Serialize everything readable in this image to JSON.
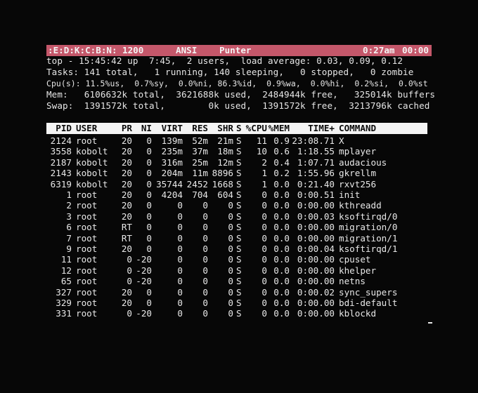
{
  "statusbar": {
    "flags": ":E:D:K:C:B:N:",
    "baud": "1200",
    "emulation": "ANSI",
    "program": "Punter",
    "clock": "0:27am",
    "timer": "00:00"
  },
  "summary": {
    "top": "top - 15:45:42 up  7:45,  2 users,  load average: 0.03, 0.09, 0.12",
    "tasks": "Tasks: 141 total,   1 running, 140 sleeping,   0 stopped,   0 zombie",
    "cpu": "Cpu(s): 11.5%us,  0.7%sy,  0.0%ni, 86.3%id,  0.9%wa,  0.0%hi,  0.2%si,  0.0%st",
    "mem": "Mem:   6106632k total,  3621688k used,  2484944k free,   325014k buffers",
    "swap": "Swap:  1391572k total,        0k used,  1391572k free,  3213796k cached"
  },
  "columns": [
    "PID",
    "USER",
    "PR",
    "NI",
    "VIRT",
    "RES",
    "SHR",
    "S",
    "%CPU",
    "%MEM",
    "TIME+",
    "COMMAND"
  ],
  "processes": [
    [
      "2124",
      "root",
      "20",
      "0",
      "139m",
      "52m",
      "21m",
      "S",
      "11",
      "0.9",
      "23:08.71",
      "X"
    ],
    [
      "3558",
      "kobolt",
      "20",
      "0",
      "235m",
      "37m",
      "18m",
      "S",
      "10",
      "0.6",
      "1:18.55",
      "mplayer"
    ],
    [
      "2187",
      "kobolt",
      "20",
      "0",
      "316m",
      "25m",
      "12m",
      "S",
      "2",
      "0.4",
      "1:07.71",
      "audacious"
    ],
    [
      "2143",
      "kobolt",
      "20",
      "0",
      "204m",
      "11m",
      "8896",
      "S",
      "1",
      "0.2",
      "1:55.96",
      "gkrellm"
    ],
    [
      "6319",
      "kobolt",
      "20",
      "0",
      "35744",
      "2452",
      "1668",
      "S",
      "1",
      "0.0",
      "0:21.40",
      "rxvt256"
    ],
    [
      "1",
      "root",
      "20",
      "0",
      "4204",
      "704",
      "604",
      "S",
      "0",
      "0.0",
      "0:00.51",
      "init"
    ],
    [
      "2",
      "root",
      "20",
      "0",
      "0",
      "0",
      "0",
      "S",
      "0",
      "0.0",
      "0:00.00",
      "kthreadd"
    ],
    [
      "3",
      "root",
      "20",
      "0",
      "0",
      "0",
      "0",
      "S",
      "0",
      "0.0",
      "0:00.03",
      "ksoftirqd/0"
    ],
    [
      "6",
      "root",
      "RT",
      "0",
      "0",
      "0",
      "0",
      "S",
      "0",
      "0.0",
      "0:00.00",
      "migration/0"
    ],
    [
      "7",
      "root",
      "RT",
      "0",
      "0",
      "0",
      "0",
      "S",
      "0",
      "0.0",
      "0:00.00",
      "migration/1"
    ],
    [
      "9",
      "root",
      "20",
      "0",
      "0",
      "0",
      "0",
      "S",
      "0",
      "0.0",
      "0:00.04",
      "ksoftirqd/1"
    ],
    [
      "11",
      "root",
      "0",
      "-20",
      "0",
      "0",
      "0",
      "S",
      "0",
      "0.0",
      "0:00.00",
      "cpuset"
    ],
    [
      "12",
      "root",
      "0",
      "-20",
      "0",
      "0",
      "0",
      "S",
      "0",
      "0.0",
      "0:00.00",
      "khelper"
    ],
    [
      "65",
      "root",
      "0",
      "-20",
      "0",
      "0",
      "0",
      "S",
      "0",
      "0.0",
      "0:00.00",
      "netns"
    ],
    [
      "327",
      "root",
      "20",
      "0",
      "0",
      "0",
      "0",
      "S",
      "0",
      "0.0",
      "0:00.02",
      "sync_supers"
    ],
    [
      "329",
      "root",
      "20",
      "0",
      "0",
      "0",
      "0",
      "S",
      "0",
      "0.0",
      "0:00.00",
      "bdi-default"
    ],
    [
      "331",
      "root",
      "0",
      "-20",
      "0",
      "0",
      "0",
      "S",
      "0",
      "0.0",
      "0:00.00",
      "kblockd"
    ]
  ],
  "colors": {
    "statusbar_bg": "#c4576a",
    "header_bg": "#f4f4f4",
    "text": "#e6e6e6",
    "background": "#070707"
  }
}
